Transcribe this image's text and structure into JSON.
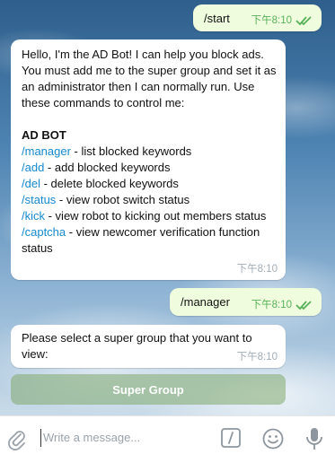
{
  "messages": [
    {
      "text": "/start",
      "time": "下午8:10"
    },
    {
      "intro": "Hello, I'm the AD Bot! I can help you block ads. You must add me to the super group and set it as an administrator then I can normally run. Use these commands to control me:",
      "heading": "AD BOT",
      "commands": [
        {
          "cmd": "/manager",
          "desc": " - list blocked keywords"
        },
        {
          "cmd": "/add",
          "desc": " - add blocked keywords"
        },
        {
          "cmd": "/del",
          "desc": " - delete blocked keywords"
        },
        {
          "cmd": "/status",
          "desc": " - view robot switch status"
        },
        {
          "cmd": "/kick",
          "desc": " - view robot to kicking out members status"
        },
        {
          "cmd": "/captcha",
          "desc": " - view newcomer verification function status"
        }
      ],
      "time": "下午8:10"
    },
    {
      "text": "/manager",
      "time": "下午8:10"
    },
    {
      "text": "Please select a super group that you want to view:",
      "time": "下午8:10"
    }
  ],
  "keyboard": {
    "button_label": "Super Group"
  },
  "composer": {
    "placeholder": "Write a message..."
  },
  "colors": {
    "outgoing_bubble": "#effdde",
    "incoming_bubble": "#ffffff",
    "command_link": "#168acd",
    "outgoing_meta": "#58b059"
  }
}
